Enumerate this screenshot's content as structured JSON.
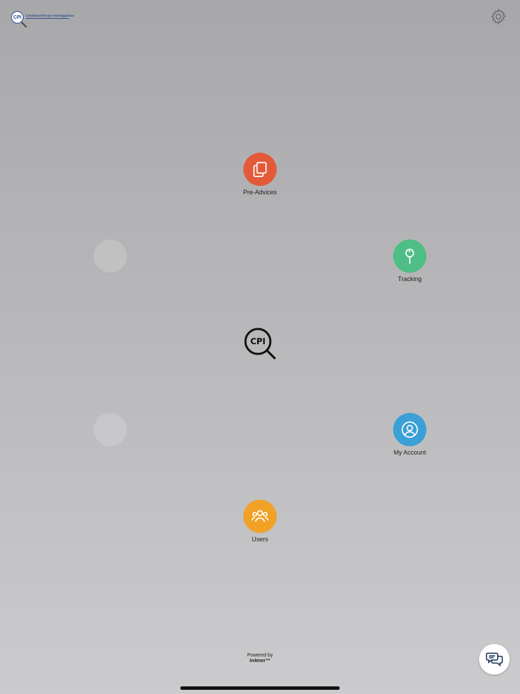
{
  "header": {
    "logo_badge": "CPI",
    "logo_text": "Combined Private Investigations",
    "settings_icon": "gear-icon"
  },
  "menu": {
    "items": [
      {
        "label": "Pre-Advices",
        "icon": "documents-copy-icon",
        "color": "#e35a3a"
      },
      {
        "label": "Tracking",
        "icon": "map-pin-icon",
        "color": "#4fbe86"
      },
      {
        "label": "My Account",
        "icon": "user-circle-icon",
        "color": "#3aa0d6"
      },
      {
        "label": "Users",
        "icon": "users-group-icon",
        "color": "#f0a126"
      }
    ]
  },
  "center": {
    "logo_text": "CPI"
  },
  "footer": {
    "powered_by": "Powered by",
    "brand": "In4mer™"
  },
  "chat": {
    "icon": "chat-bubbles-icon"
  }
}
